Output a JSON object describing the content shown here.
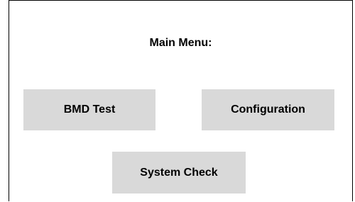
{
  "main_menu": {
    "title": "Main Menu:",
    "buttons": {
      "bmd_test": "BMD Test",
      "configuration": "Configuration",
      "system_check": "System Check"
    }
  },
  "colors": {
    "button_bg": "#d9d9d9",
    "frame_border": "#000000",
    "background": "#ffffff"
  }
}
